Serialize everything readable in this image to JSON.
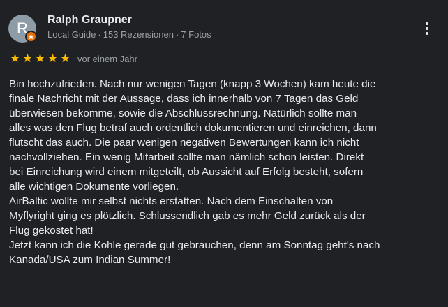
{
  "reviewer": {
    "initial": "R",
    "name": "Ralph Graupner",
    "level": "Local Guide",
    "reviews": "153 Rezensionen",
    "photos": "7 Fotos",
    "separator": "·"
  },
  "rating": {
    "stars": 5,
    "max": 5,
    "star_glyph": "★",
    "date": "vor einem Jahr"
  },
  "review_text": [
    "Bin hochzufrieden. Nach nur wenigen Tagen (knapp 3 Wochen) kam heute die",
    "finale Nachricht mit der Aussage, dass ich innerhalb von 7 Tagen das Geld",
    "überwiesen bekomme, sowie die Abschlussrechnung. Natürlich sollte man",
    "alles was den Flug betraf auch ordentlich dokumentieren und einreichen, dann",
    "flutscht das auch. Die paar wenigen negativen Bewertungen kann ich nicht",
    "nachvollziehen. Ein wenig Mitarbeit sollte man nämlich schon leisten. Direkt",
    "bei Einreichung wird einem mitgeteilt, ob Aussicht auf Erfolg besteht, sofern",
    "alle wichtigen Dokumente vorliegen.",
    "AirBaltic wollte mir selbst nichts erstatten. Nach dem Einschalten von",
    "Myflyright ging es plötzlich. Schlussendlich gab es mehr Geld zurück als der",
    "Flug gekostet hat!",
    "Jetzt kann ich die Kohle gerade gut gebrauchen, denn am Sonntag geht's nach",
    "Kanada/USA zum Indian Summer!"
  ],
  "colors": {
    "background": "#202124",
    "star": "#fbbc04",
    "badge": "#e8710a",
    "avatar": "#8e9ca7",
    "text_primary": "#e8eaed",
    "text_secondary": "#9aa0a6"
  },
  "icons": {
    "more": "more-vert-icon",
    "badge": "local-guide-badge-icon",
    "star": "star-icon"
  }
}
